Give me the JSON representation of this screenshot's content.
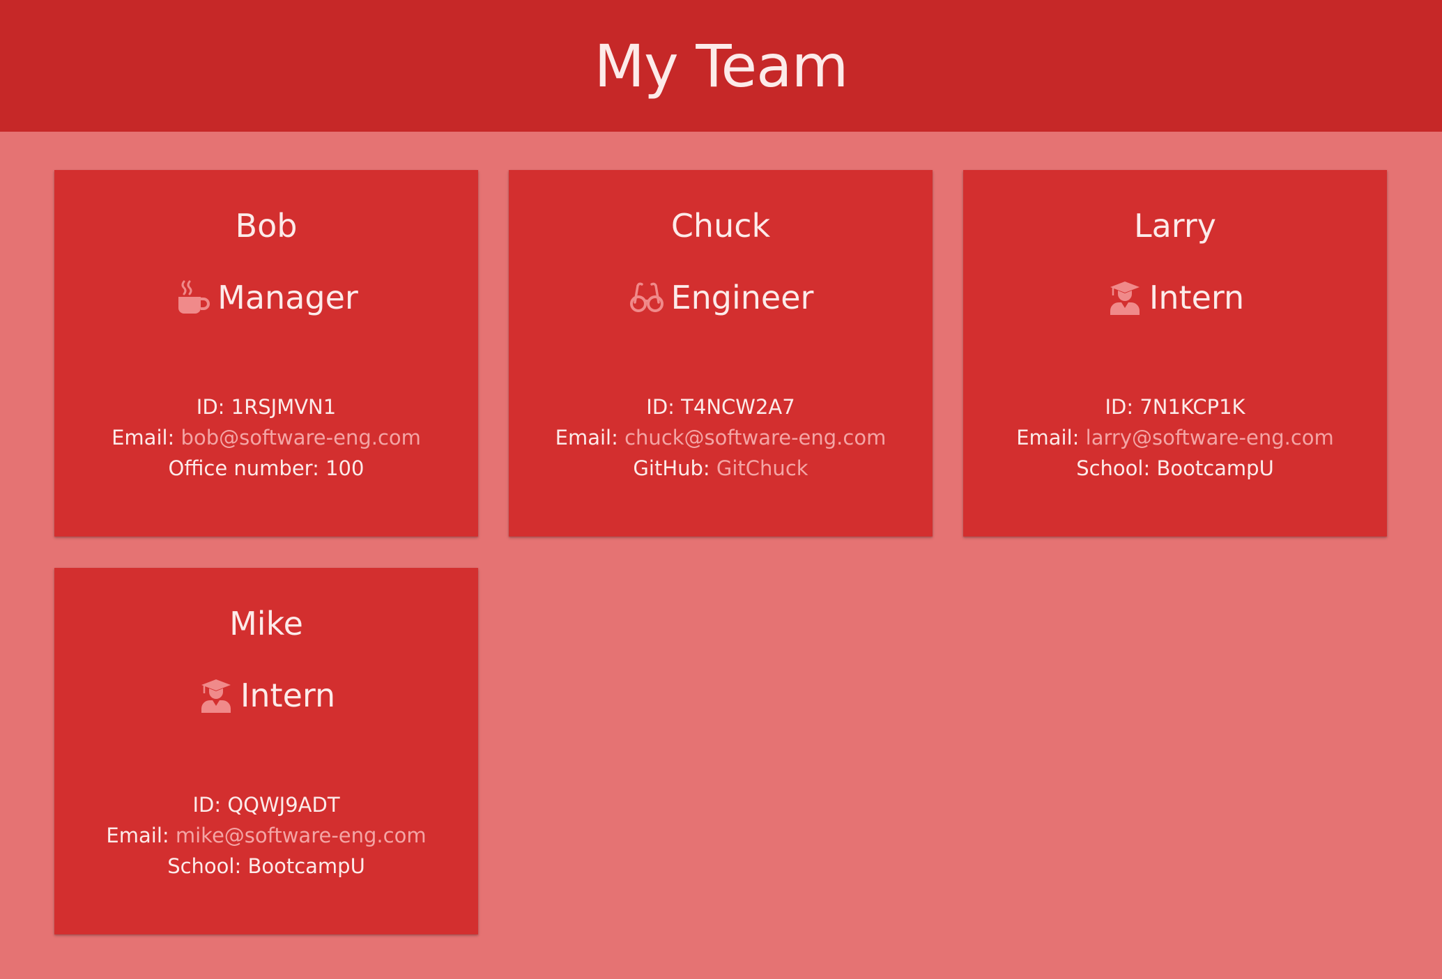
{
  "header": {
    "title": "My Team"
  },
  "team": [
    {
      "name": "Bob",
      "role": "Manager",
      "icon": "coffee-icon",
      "id_label": "ID:",
      "id": "1RSJMVN1",
      "email_label": "Email:",
      "email": "bob@software-eng.com",
      "extra_label": "Office number:",
      "extra_value": "100"
    },
    {
      "name": "Chuck",
      "role": "Engineer",
      "icon": "glasses-icon",
      "id_label": "ID:",
      "id": "T4NCW2A7",
      "email_label": "Email:",
      "email": "chuck@software-eng.com",
      "extra_label": "GitHub:",
      "extra_value": "GitChuck"
    },
    {
      "name": "Larry",
      "role": "Intern",
      "icon": "graduate-icon",
      "id_label": "ID:",
      "id": "7N1KCP1K",
      "email_label": "Email:",
      "email": "larry@software-eng.com",
      "extra_label": "School:",
      "extra_value": "BootcampU"
    },
    {
      "name": "Mike",
      "role": "Intern",
      "icon": "graduate-icon",
      "id_label": "ID:",
      "id": "QQWJ9ADT",
      "email_label": "Email:",
      "email": "mike@software-eng.com",
      "extra_label": "School:",
      "extra_value": "BootcampU"
    }
  ],
  "colors": {
    "header_bg": "#c62828",
    "page_bg": "#e57373",
    "card_bg": "#d32f2f",
    "text": "#fcebea",
    "link": "#f4a5a5",
    "icon": "#f08a8a"
  }
}
